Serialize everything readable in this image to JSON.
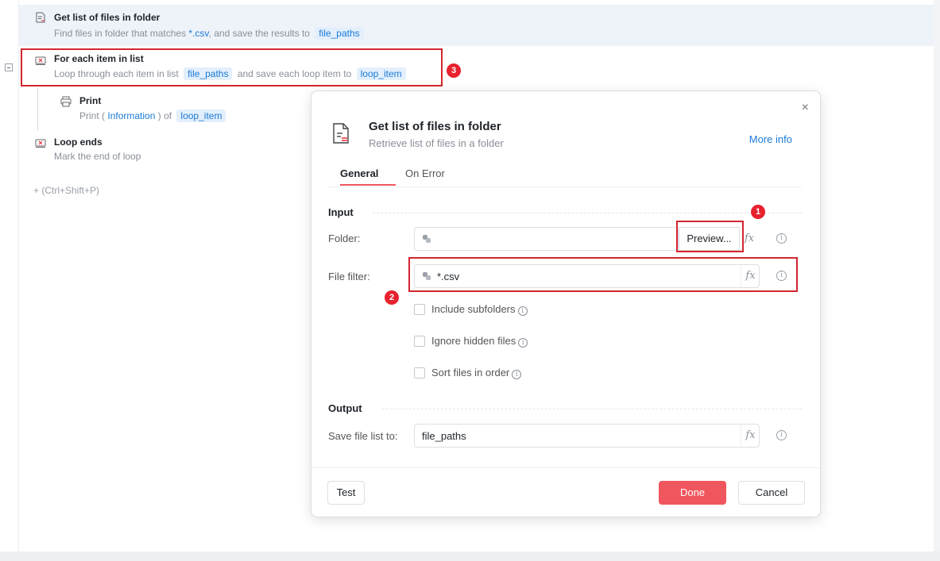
{
  "flow": {
    "step1": {
      "title": "Get list of files in folder",
      "desc_pre": "Find files in folder   that matches",
      "filter": "*.csv",
      "desc_mid": ", and save the results to",
      "var": "file_paths"
    },
    "step2": {
      "title": "For each item in list",
      "desc_pre": "Loop through each item in list",
      "list_var": "file_paths",
      "desc_mid": "and save each loop item to",
      "item_var": "loop_item"
    },
    "step3": {
      "title": "Print",
      "desc_pre": "Print (",
      "level": "Information",
      "desc_mid": ") of",
      "var": "loop_item"
    },
    "step4": {
      "title": "Loop ends",
      "desc": "Mark the end of loop"
    },
    "add_step": "+  (Ctrl+Shift+P)"
  },
  "badges": {
    "b1": "1",
    "b2": "2",
    "b3": "3"
  },
  "dialog": {
    "close": "×",
    "title": "Get list of files in folder",
    "subtitle": "Retrieve list of files in a folder",
    "more_info": "More info",
    "tabs": {
      "general": "General",
      "on_error": "On Error"
    },
    "input_section": "Input",
    "folder_label": "Folder:",
    "folder_value": "",
    "preview": "Preview...",
    "filter_label": "File filter:",
    "filter_value": "*.csv",
    "fx": "fx",
    "info": "i",
    "include_subfolders": "Include subfolders",
    "ignore_hidden": "Ignore hidden files",
    "sort_files": "Sort files in order",
    "output_section": "Output",
    "save_label": "Save file list to:",
    "save_value": "file_paths",
    "test": "Test",
    "done": "Done",
    "cancel": "Cancel"
  },
  "colors": {
    "accent": "#1a7ad6",
    "primary_button": "#f0565d",
    "highlight_box": "#d4262f",
    "badge": "#e8212e"
  }
}
